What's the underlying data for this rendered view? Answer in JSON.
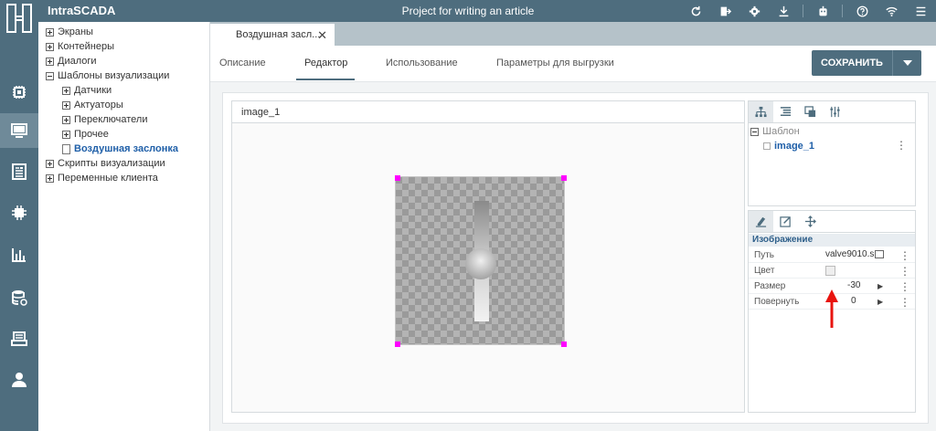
{
  "topbar": {
    "app_title": "IntraSCADA",
    "project_title": "Project for writing an article",
    "icons": [
      "refresh-icon",
      "export-icon",
      "settings-icon",
      "download-icon",
      "robot-icon",
      "help-icon",
      "wifi-icon",
      "menu-icon"
    ]
  },
  "rail": {
    "items": [
      "devices-icon",
      "screens-icon",
      "documents-icon",
      "modules-icon",
      "charts-icon",
      "database-icon",
      "archive-icon",
      "user-icon"
    ]
  },
  "tree": {
    "items": [
      {
        "label": "Экраны"
      },
      {
        "label": "Контейнеры"
      },
      {
        "label": "Диалоги"
      },
      {
        "label": "Шаблоны визуализации"
      },
      {
        "label": "Датчики"
      },
      {
        "label": "Актуаторы"
      },
      {
        "label": "Переключатели"
      },
      {
        "label": "Прочее"
      },
      {
        "label": "Воздушная заслонка"
      },
      {
        "label": "Скрипты визуализации"
      },
      {
        "label": "Переменные клиента"
      }
    ]
  },
  "file_tab": {
    "label": "Воздушная засл..."
  },
  "subtabs": [
    "Описание",
    "Редактор",
    "Использование",
    "Параметры для выгрузки"
  ],
  "save_button": {
    "label": "СОХРАНИТЬ"
  },
  "canvas": {
    "title": "image_1"
  },
  "layers": {
    "group_label": "Шаблон",
    "item_label": "image_1"
  },
  "properties": {
    "section": "Изображение",
    "rows": [
      {
        "label": "Путь",
        "value": "valve9010.s"
      },
      {
        "label": "Цвет",
        "value": ""
      },
      {
        "label": "Размер",
        "value": "-30"
      },
      {
        "label": "Повернуть",
        "value": "0"
      }
    ]
  },
  "colors": {
    "header": "#4e6d7e",
    "selected_text": "#1f5fa8",
    "handle": "#ff00ff",
    "annotation_arrow": "#e8140f"
  }
}
